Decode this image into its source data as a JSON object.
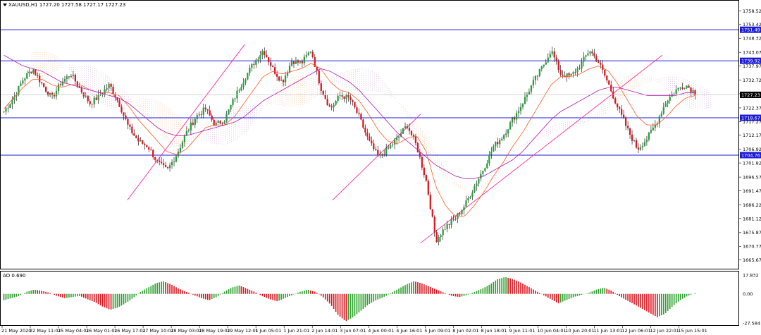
{
  "window": {
    "symbol_header": "XAUUSD,H1  1727.20 1727.58 1727.17 1727.23"
  },
  "ao_panel": {
    "title": "AO 0.690"
  },
  "colors": {
    "bull": "#26a03c",
    "bear": "#e0141e",
    "wick": "#000000",
    "level": "#1b1bd6",
    "trend": "#ff2aa0",
    "ma_fast": "#ff5a1e",
    "ma_slow": "#b01ab0",
    "cloud_a": "#f4a46a",
    "cloud_b": "#c89ad8",
    "ao_up": "#2ca02c",
    "ao_down": "#e0141e"
  },
  "chart_data": {
    "type": "candlestick",
    "title": "XAUUSD,H1",
    "last_price": "1727.23",
    "ylim": [
      1664.0,
      1761.0
    ],
    "y_ticks": [
      "1758.52",
      "1753.42",
      "1748.32",
      "1743.07",
      "1737.97",
      "1732.72",
      "1727.62",
      "1722.37",
      "1717.27",
      "1712.17",
      "1706.92",
      "1701.82",
      "1696.57",
      "1691.47",
      "1686.22",
      "1681.12",
      "1675.87",
      "1670.77",
      "1665.67"
    ],
    "x_ticks": [
      "21 May 2020",
      "22 May 11:01",
      "25 May 04:01",
      "26 May 01:01",
      "26 May 17:01",
      "27 May 10:01",
      "28 May 03:01",
      "28 May 19:01",
      "29 May 12:01",
      "1 Jun 05:01",
      "1 Jun 21:01",
      "2 Jun 14:01",
      "3 Jun 07:01",
      "4 Jun 00:01",
      "4 Jun 16:01",
      "5 Jun 09:01",
      "8 Jun 02:01",
      "8 Jun 18:01",
      "9 Jun 11:01",
      "10 Jun 04:01",
      "10 Jun 20:01",
      "11 Jun 13:01",
      "12 Jun 06:01",
      "12 Jun 22:01",
      "15 Jun 15:01"
    ],
    "horizontal_levels": [
      "1751.49",
      "1739.92",
      "1718.67",
      "1704.76"
    ],
    "price_path": [
      1721,
      1726,
      1733,
      1737,
      1731,
      1726,
      1732,
      1735,
      1729,
      1724,
      1727,
      1731,
      1724,
      1715,
      1710,
      1708,
      1702,
      1699,
      1705,
      1713,
      1719,
      1722,
      1716,
      1718,
      1726,
      1733,
      1739,
      1744,
      1737,
      1732,
      1740,
      1739,
      1744,
      1730,
      1722,
      1727,
      1726,
      1719,
      1710,
      1704,
      1707,
      1711,
      1716,
      1708,
      1695,
      1673,
      1678,
      1681,
      1686,
      1693,
      1700,
      1708,
      1712,
      1718,
      1724,
      1731,
      1737,
      1744,
      1735,
      1734,
      1738,
      1744,
      1739,
      1731,
      1722,
      1714,
      1707,
      1711,
      1717,
      1725,
      1729,
      1731,
      1728
    ],
    "ma_fast_path": [
      1722,
      1726,
      1730,
      1733,
      1733,
      1731,
      1730,
      1731,
      1731,
      1729,
      1728,
      1728,
      1727,
      1723,
      1718,
      1714,
      1710,
      1706,
      1705,
      1707,
      1711,
      1715,
      1716,
      1716,
      1719,
      1724,
      1729,
      1734,
      1736,
      1735,
      1736,
      1737,
      1739,
      1737,
      1732,
      1729,
      1728,
      1725,
      1720,
      1714,
      1710,
      1709,
      1711,
      1712,
      1706,
      1693,
      1686,
      1682,
      1682,
      1686,
      1691,
      1697,
      1702,
      1708,
      1713,
      1719,
      1725,
      1731,
      1734,
      1734,
      1735,
      1737,
      1738,
      1736,
      1731,
      1725,
      1719,
      1716,
      1716,
      1719,
      1723,
      1726,
      1727
    ],
    "ma_slow_path": [
      1742,
      1740,
      1738,
      1737,
      1736,
      1734,
      1732,
      1731,
      1730,
      1729,
      1728,
      1727,
      1726,
      1724,
      1721,
      1718,
      1715,
      1713,
      1712,
      1712,
      1713,
      1714,
      1715,
      1716,
      1717,
      1719,
      1722,
      1725,
      1727,
      1729,
      1731,
      1733,
      1735,
      1737,
      1736,
      1734,
      1732,
      1729,
      1725,
      1721,
      1717,
      1713,
      1710,
      1707,
      1704,
      1701,
      1699,
      1697,
      1696,
      1696,
      1697,
      1699,
      1701,
      1703,
      1706,
      1710,
      1714,
      1718,
      1721,
      1723,
      1725,
      1727,
      1729,
      1730,
      1730,
      1729,
      1728,
      1727,
      1727,
      1727,
      1727,
      1728,
      1728
    ],
    "trendlines": [
      {
        "from": [
          0.17,
          1688
        ],
        "to": [
          0.33,
          1746
        ]
      },
      {
        "from": [
          0.45,
          1688
        ],
        "to": [
          0.57,
          1720
        ]
      },
      {
        "from": [
          0.57,
          1672
        ],
        "to": [
          0.9,
          1742
        ]
      }
    ],
    "ao": {
      "ylim": [
        -27.584,
        17.832
      ],
      "y_ticks": [
        "17.832",
        "0.00",
        "-27.584"
      ],
      "values": [
        -6,
        -4,
        -2,
        2,
        4,
        3,
        1,
        -2,
        -4,
        -3,
        -2,
        -5,
        -8,
        -12,
        -15,
        -13,
        -9,
        -4,
        2,
        6,
        10,
        12,
        9,
        5,
        2,
        -1,
        -4,
        -6,
        -3,
        2,
        6,
        8,
        5,
        2,
        -2,
        -5,
        -7,
        -4,
        -1,
        2,
        4,
        2,
        -3,
        -10,
        -20,
        -26,
        -22,
        -16,
        -10,
        -6,
        -3,
        1,
        5,
        9,
        12,
        10,
        7,
        4,
        1,
        -2,
        -3,
        -1,
        2,
        5,
        9,
        14,
        16,
        14,
        11,
        7,
        3,
        -1,
        -5,
        -9,
        -6,
        -3,
        -1,
        1,
        4,
        6,
        3,
        -2,
        -6,
        -10,
        -14,
        -18,
        -22,
        -19,
        -12,
        -6,
        -2,
        0.69
      ]
    }
  }
}
